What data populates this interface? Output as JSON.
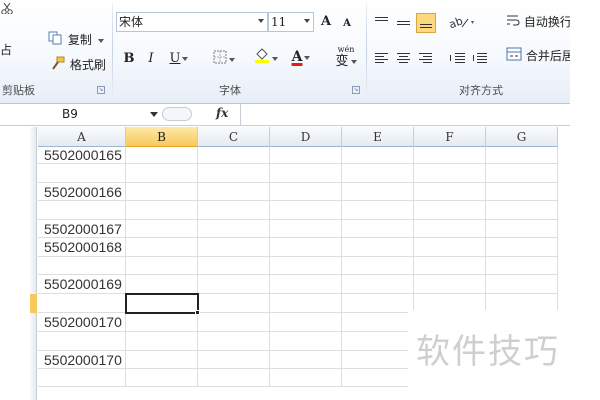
{
  "ribbon": {
    "clipboard": {
      "paste_partial": "占",
      "cut_label": "",
      "copy_label": "复制",
      "format_painter_label": "格式刷",
      "group_label": "剪贴板"
    },
    "font": {
      "font_name": "宋体",
      "font_size": "11",
      "bold": "B",
      "italic": "I",
      "underline": "U",
      "grow_label": "A",
      "shrink_label": "A",
      "font_color_label": "A",
      "phonetic_top": "wén",
      "phonetic_char": "变",
      "group_label": "字体"
    },
    "alignment": {
      "wrap_text_label": "自动换行",
      "merge_center_label": "合并后居",
      "group_label": "对齐方式"
    }
  },
  "formula_bar": {
    "name_box": "B9",
    "fx_label": "fx",
    "formula": ""
  },
  "grid": {
    "columns": [
      "A",
      "B",
      "C",
      "D",
      "E",
      "F",
      "G"
    ],
    "active_column": "B",
    "rows": [
      {
        "a": "5502000165"
      },
      {
        "a": ""
      },
      {
        "a": "5502000166"
      },
      {
        "a": ""
      },
      {
        "a": "5502000167"
      },
      {
        "a": "5502000168"
      },
      {
        "a": ""
      },
      {
        "a": "5502000169"
      },
      {
        "a": ""
      },
      {
        "a": "5502000170"
      },
      {
        "a": ""
      },
      {
        "a": "5502000170"
      },
      {
        "a": ""
      }
    ]
  },
  "watermark": "软件技巧",
  "colors": {
    "active_header": "#f7c85c",
    "font_color_bar": "#e31b1b",
    "highlight_bar": "#ffff00",
    "gridline": "#dadfe6"
  }
}
